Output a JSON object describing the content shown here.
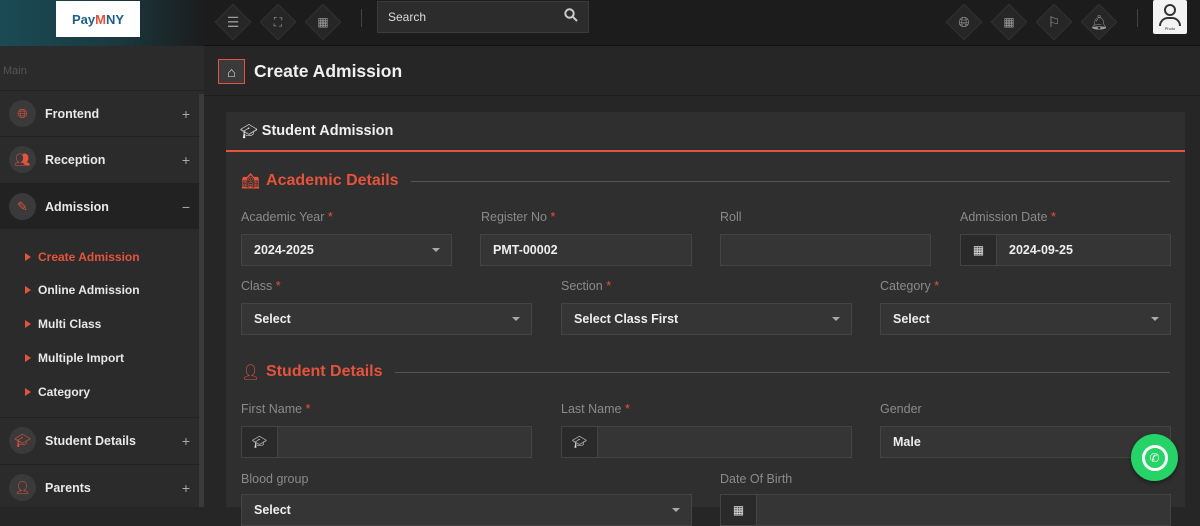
{
  "topbar": {
    "logo": {
      "part1": "Pay",
      "part2": "M",
      "part3": "NY"
    },
    "search_placeholder": "Search",
    "avatar_label": "Photo"
  },
  "sidebar": {
    "section_label": "Main",
    "items": [
      {
        "label": "Frontend",
        "toggle": "+"
      },
      {
        "label": "Reception",
        "toggle": "+"
      },
      {
        "label": "Admission",
        "toggle": "−"
      },
      {
        "label": "Student Details",
        "toggle": "+"
      },
      {
        "label": "Parents",
        "toggle": "+"
      }
    ],
    "submenu": [
      {
        "label": "Create Admission"
      },
      {
        "label": "Online Admission"
      },
      {
        "label": "Multi Class"
      },
      {
        "label": "Multiple Import"
      },
      {
        "label": "Category"
      }
    ]
  },
  "breadcrumb": {
    "title": "Create Admission"
  },
  "panel": {
    "title": "Student Admission",
    "academic": {
      "heading": "Academic Details",
      "academic_year": {
        "label": "Academic Year",
        "value": "2024-2025"
      },
      "register_no": {
        "label": "Register No",
        "value": "PMT-00002"
      },
      "roll": {
        "label": "Roll",
        "value": ""
      },
      "admission_date": {
        "label": "Admission Date",
        "value": "2024-09-25"
      },
      "class": {
        "label": "Class",
        "value": "Select"
      },
      "section": {
        "label": "Section",
        "value": "Select Class First"
      },
      "category": {
        "label": "Category",
        "value": "Select"
      }
    },
    "student": {
      "heading": "Student Details",
      "first_name": {
        "label": "First Name",
        "value": ""
      },
      "last_name": {
        "label": "Last Name",
        "value": ""
      },
      "gender": {
        "label": "Gender",
        "value": "Male"
      },
      "blood_group": {
        "label": "Blood group",
        "value": "Select"
      },
      "dob": {
        "label": "Date Of Birth",
        "value": ""
      }
    },
    "required_mark": "*"
  },
  "colors": {
    "accent": "#e5533d",
    "whatsapp": "#25d366"
  }
}
